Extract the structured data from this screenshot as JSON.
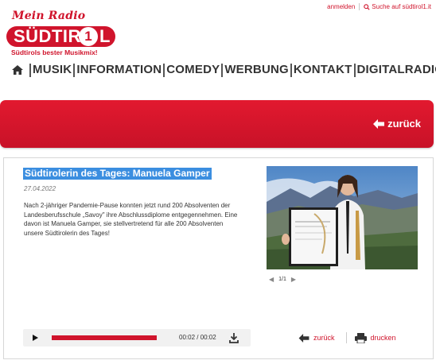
{
  "toplinks": {
    "login": "anmelden",
    "search": "Suche auf südtirol1.it"
  },
  "logo": {
    "mein": "Mein Radio",
    "brand": "SÜDTIR",
    "number": "1",
    "tail": "L",
    "tagline": "Südtirols bester Musikmix!"
  },
  "nav": {
    "items": [
      "MUSIK",
      "INFORMATION",
      "COMEDY",
      "WERBUNG",
      "KONTAKT",
      "DIGITALRADIO"
    ]
  },
  "banner": {
    "back_label": "zurück"
  },
  "article": {
    "title": "Südtirolerin des Tages: Manuela Gamper",
    "date": "27.04.2022",
    "body": "Nach 2-jähriger Pandemie-Pause konnten jetzt rund 200 Absolventen der Landesberufsschule „Savoy\" ihre Abschlussdiplome entgegennehmen. Eine davon ist Manuela Gamper, sie stellvertretend für alle 200 Absolventen unsere Südtirolerin des Tages!"
  },
  "gallery": {
    "counter": "1/1"
  },
  "player": {
    "time": "00:02 / 00:02",
    "progress": 1.0
  },
  "actions": {
    "back": "zurück",
    "print": "drucken"
  },
  "colors": {
    "brand_red": "#d0142c",
    "highlight_blue": "#3b8ee0"
  }
}
